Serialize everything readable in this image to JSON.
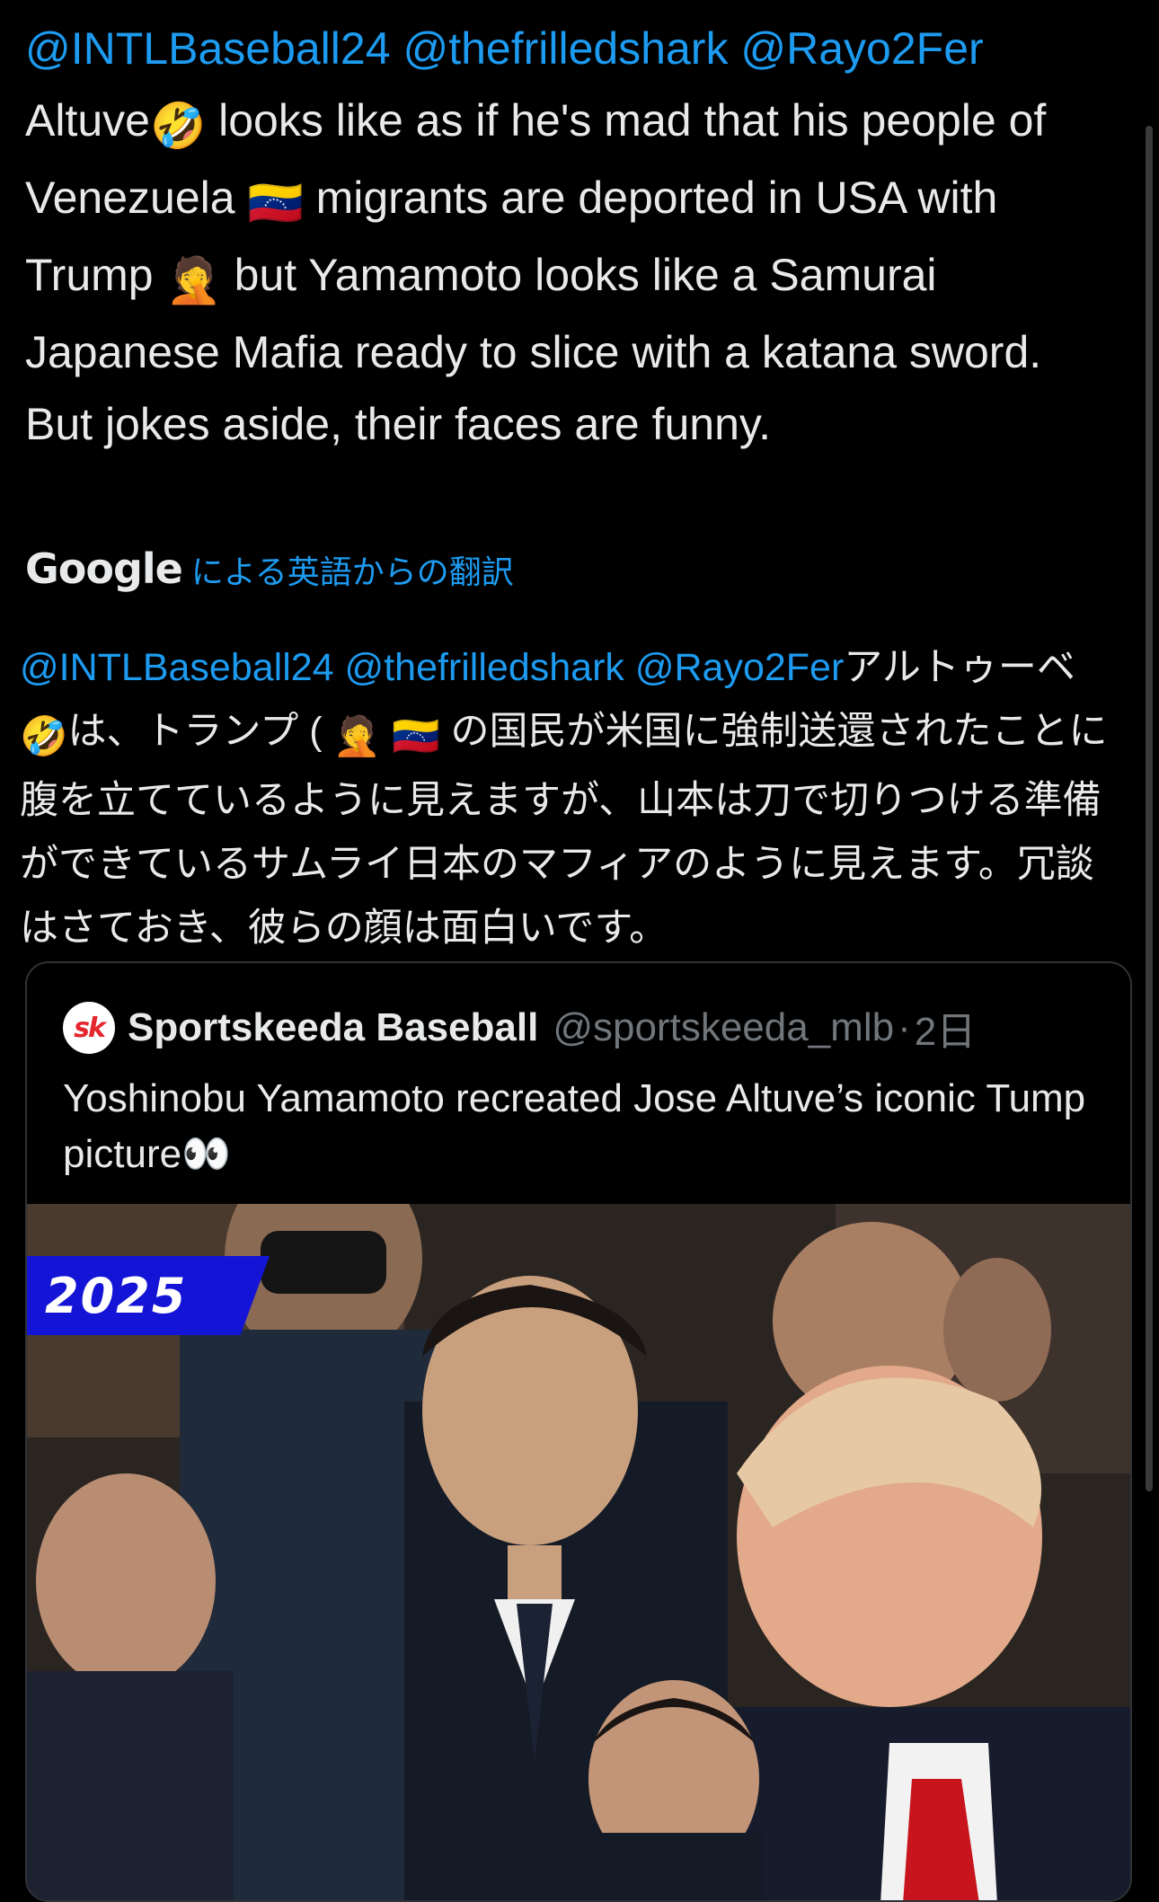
{
  "post": {
    "mentions": [
      "@INTLBaseball24",
      "@thefrilledshark",
      "@Rayo2Fer"
    ],
    "text_part1": "Altuve",
    "emoji_rofl": "🤣",
    "text_part2": " looks like as if he's mad that his people of Venezuela ",
    "emoji_flag": "🇻🇪",
    "text_part3": " migrants are deported in USA with Trump ",
    "emoji_facepalm": "🤦",
    "text_part4": " but Yamamoto looks like a Samurai Japanese Mafia ready to slice with a katana sword. But jokes aside, their faces are funny."
  },
  "translation": {
    "provider": "Google",
    "label": "による英語からの翻訳",
    "mentions_text": "@INTLBaseball24 @thefrilledshark @Rayo2Fer",
    "text_part1": "アルトゥーベ",
    "emoji_rofl": "🤣",
    "text_part2": "は、トランプ ( ",
    "emoji_facepalm": "🤦",
    "emoji_flag": "🇻🇪",
    "text_part3": " の国民が米国に強制送還されたことに腹を立てているように見えますが、山本は刀で切りつける準備ができているサムライ日本のマフィアのように見えます。冗談はさておき、彼らの顔は面白いです。"
  },
  "quote": {
    "logo_text": "sk",
    "name": "Sportskeeda Baseball",
    "handle": "@sportskeeda_mlb",
    "separator": "·",
    "time": "2日",
    "text": "Yoshinobu Yamamoto recreated Jose Altuve’s iconic Tump picture",
    "emoji_eyes": "👀",
    "media": {
      "badge_text": "2025"
    }
  },
  "colors": {
    "background": "#000000",
    "text": "#e7e9ea",
    "link": "#1d9bf0",
    "muted": "#71767b",
    "border": "#2f3336",
    "badge": "#1414d6"
  }
}
